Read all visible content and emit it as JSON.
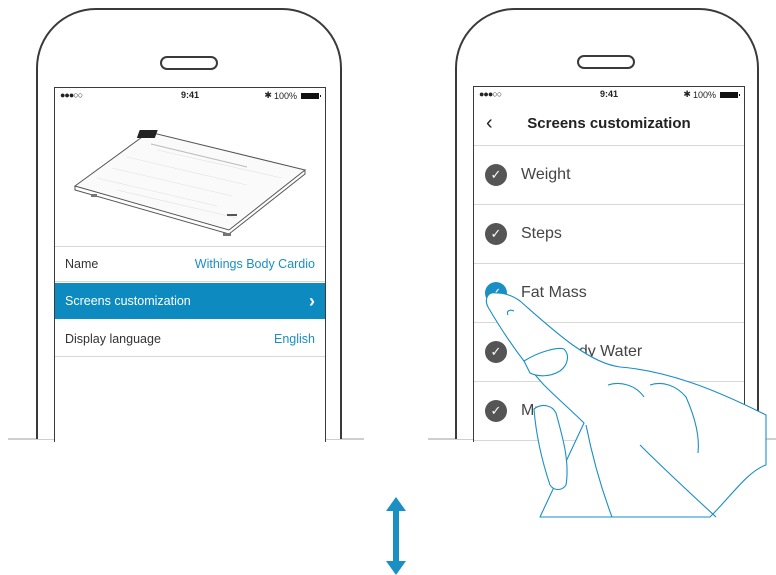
{
  "left_phone": {
    "status": {
      "signal": "●●●○○",
      "time": "9:41",
      "bluetooth": "✱",
      "battery": "100%"
    },
    "rows": [
      {
        "label": "Name",
        "value": "Withings Body Cardio"
      },
      {
        "label": "Screens customization",
        "value": "›"
      },
      {
        "label": "Display language",
        "value": "English"
      }
    ]
  },
  "right_phone": {
    "status": {
      "signal": "●●●○○",
      "time": "9:41",
      "bluetooth": "✱",
      "battery": "100%"
    },
    "nav": {
      "back": "‹",
      "title": "Screens customization"
    },
    "metrics": [
      {
        "label": "Weight",
        "checked": true
      },
      {
        "label": "Steps",
        "checked": true
      },
      {
        "label": "Fat Mass",
        "checked": true,
        "highlight": true
      },
      {
        "label": "Total Body Water",
        "checked": true
      },
      {
        "label": "Mu",
        "checked": true
      }
    ]
  },
  "colors": {
    "accent": "#0d8bc0",
    "outline": "#3a3a3a",
    "check": "#555555"
  }
}
